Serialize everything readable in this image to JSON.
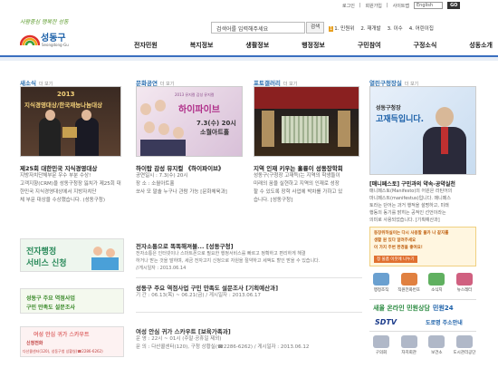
{
  "top_links": {
    "login": "로그인",
    "join": "회원가입",
    "sitemap": "사이트맵",
    "language": "English",
    "go": "GO"
  },
  "header": {
    "slogan": "사람중심 행복한 성동",
    "logo": "성동구",
    "logo_sub": "Seongdong-Gu",
    "search_value": "검색어를 입력해주세요",
    "search_button": "검색",
    "complaint_badge": "1",
    "complaints": [
      "1. 민원위",
      "2. 재개발",
      "3. 이수",
      "4. 어린이집"
    ]
  },
  "nav": [
    "전자민원",
    "복지정보",
    "생활정보",
    "행정정보",
    "구민참여",
    "구정소식",
    "성동소개"
  ],
  "columns": [
    {
      "head": "새소식",
      "more": "더 보기",
      "title": "제25회 대한민국 지식경영대상",
      "body": [
        "지방자치단체부문 우수 부분 수상!",
        "고객지향(CRM)을 성동구청장 잃치가 제25회 대",
        "한민국 지식경영대상에서 지방자치단",
        "체 부문 대상을 수상했습니다. (성동구청)"
      ],
      "image_text": [
        "2013",
        "지식경영대상/한국재능나눔대상"
      ]
    },
    {
      "head": "문화공연",
      "more": "더 보기",
      "title": "하이탑 감성 뮤지컬 《하이파이브》",
      "body": [
        "공연일시 : 7.3(수) 20시",
        "장 소 : 소월아트홀",
        "쏘사 모 말솔 누구나 관람 가능 [문화체육과]"
      ],
      "image_text": [
        "2013 뮤지컬 감성 뮤지컬",
        "하이파이브",
        "7.3(수) 20시",
        "소월아트홀"
      ]
    },
    {
      "head": "포토갤러리",
      "more": "더 보기",
      "title": "지역 인재 키우는 훌륭이 성동장학회",
      "body": [
        "성동구(구청장 고재득)는 지역의 학생들이",
        "미래의 꿈을 실현하고 지역의 인재로 성장",
        "할 수 있도록 장학 사업에 박차를 가하고 있",
        "습니다. [성동구청]"
      ]
    },
    {
      "head": "열린구청장실",
      "more": "더 보기",
      "title": "[매니페스토] 구민과의 약속-공약실천",
      "body": [
        "매니페스토(Manifesto)의 어원은 라틴어의",
        "마니페스트(manifestus)입니다. 매니페스",
        "토라는 단어는 과거 행적을 설명하고, 미래",
        "행동의 동기를 밝히는 공적인 선언이라는",
        "의미로 사용되었습니다. [기획예산과]"
      ],
      "image_text": [
        "성동구청장",
        "고재득입니다."
      ]
    }
  ],
  "banners": [
    {
      "line1": "전자행정",
      "line2": "서비스 신청"
    },
    {
      "line1": "성동구 주요 역점사업",
      "line2": "구민 만족도 설문조사"
    },
    {
      "line1": "여성 안심 귀가 스카우트",
      "line2": "신청전화",
      "line3": "다산콜센터(120), 성동구청 상황실(☎2286-6262)"
    }
  ],
  "rows": [
    {
      "title": "전자소통으로 똑똑해져볼... [성동구청]",
      "body": [
        "전자소통은 인터넷이나 스마트폰으로 필요한 행정서비스를 빠르고 정확하고 편리하게 해결",
        "하거나 받는 것을 말하며, 세금 전자고지 신청으로 자원을 절약하고 세액도 할인 받을 수 있습니다.",
        "//게시일자 : 2013.06.14"
      ],
      "date": "2013.06.14"
    },
    {
      "title": "성동구 주요 역점사업 구민 만족도 설문조사 [기획예산과]",
      "body": [
        "기 간 : 06.13(목) ~ 06.21(금) / 게시일자 : 2013.06.17"
      ]
    },
    {
      "title": "여성 안심 귀가 스카우트 [보육가족과]",
      "body": [
        "운 영 : 22시 ~ 01시 (주말·공휴일 제외)",
        "문 의 : 다산콜센터(120), 구청 상황실(☎2286-6262) / 게시일자 : 2013.06.12"
      ]
    }
  ],
  "right": {
    "banner": [
      "동장위하실이는 다시 사용할 물카 나 같지를",
      "생활 원 있다 알려주세요",
      "이 가지 주변 환경을 좋여요!"
    ],
    "banner_button": "청 물품 이웃에 나누기",
    "icons": [
      "행정조직",
      "직원전화번호",
      "소식지",
      "뉴스레터"
    ],
    "link1": "새올 온라인 민원상담",
    "link2": "민원24",
    "link3": "SDTV",
    "link4": "도로명 주소안내",
    "bottom": [
      "구의회",
      "자치회관",
      "보건소",
      "도시관리공단"
    ]
  },
  "colors": {
    "nav_line": "#3a6fbf",
    "accent": "#2a6fb0",
    "orange": "#e8a020"
  }
}
